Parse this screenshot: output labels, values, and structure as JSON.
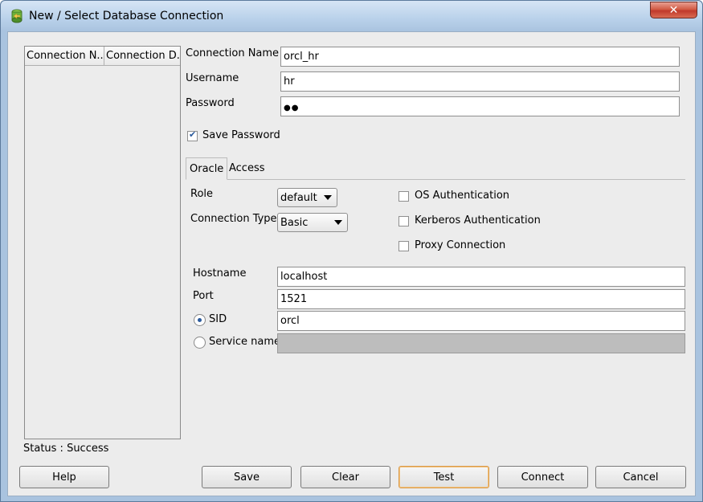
{
  "window": {
    "title": "New / Select Database Connection",
    "close_glyph": "✕"
  },
  "connections_list": {
    "columns": [
      "Connection N...",
      "Connection D..."
    ],
    "rows": []
  },
  "status": "Status : Success",
  "form": {
    "connection_name": {
      "label": "Connection Name",
      "value": "orcl_hr"
    },
    "username": {
      "label": "Username",
      "value": "hr"
    },
    "password": {
      "label": "Password",
      "masked": "●●"
    },
    "save_password": {
      "label": "Save Password",
      "checked": true
    }
  },
  "tabs": [
    {
      "label": "Oracle",
      "active": true
    },
    {
      "label": "Access",
      "active": false
    }
  ],
  "oracle": {
    "role": {
      "label": "Role",
      "value": "default"
    },
    "connection_type": {
      "label": "Connection Type",
      "value": "Basic"
    },
    "os_auth": {
      "label": "OS Authentication",
      "checked": false
    },
    "kerberos_auth": {
      "label": "Kerberos Authentication",
      "checked": false
    },
    "proxy_connection": {
      "label": "Proxy Connection",
      "checked": false
    },
    "hostname": {
      "label": "Hostname",
      "value": "localhost"
    },
    "port": {
      "label": "Port",
      "value": "1521"
    },
    "sid": {
      "label": "SID",
      "value": "orcl",
      "selected": true
    },
    "service_name": {
      "label": "Service name",
      "value": "",
      "selected": false,
      "enabled": false
    }
  },
  "buttons": {
    "help": "Help",
    "save": "Save",
    "clear": "Clear",
    "test": "Test",
    "connect": "Connect",
    "cancel": "Cancel"
  },
  "icons": {
    "app": "database-connection-icon",
    "close": "close-icon"
  },
  "colors": {
    "title_bg": "#b9d1ea",
    "client_bg": "#ececec",
    "close_bg": "#c0392b",
    "default_button_border": "#d99a4a"
  }
}
